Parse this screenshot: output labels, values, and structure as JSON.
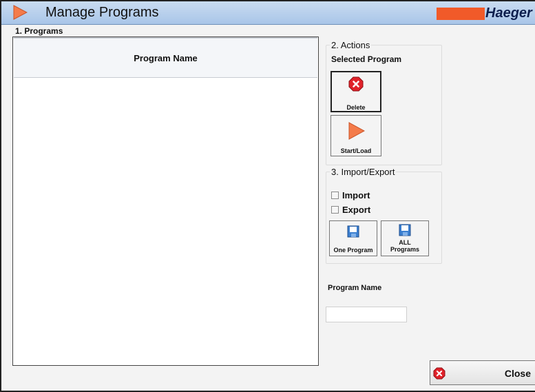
{
  "window": {
    "title": "Manage Programs",
    "brand": "Haeger",
    "brand_color": "#f15a29",
    "title_icon": "play-arrow-icon"
  },
  "programs": {
    "group_label": "1. Programs",
    "columns": [
      "Program Name"
    ],
    "rows": []
  },
  "actions": {
    "group_label": "2. Actions",
    "sub_label": "Selected Program",
    "delete_label": "Delete",
    "delete_icon": "delete-x-icon",
    "start_label": "Start/Load",
    "start_icon": "play-arrow-icon"
  },
  "import_export": {
    "group_label": "3. Import/Export",
    "import_label": "Import",
    "import_checked": false,
    "export_label": "Export",
    "export_checked": false,
    "one_program_label": "One Program",
    "all_programs_label_1": "ALL",
    "all_programs_label_2": "Programs",
    "save_icon": "floppy-disk-icon"
  },
  "program_name": {
    "label": "Program Name",
    "value": ""
  },
  "close_label": "Close",
  "close_icon": "close-x-icon"
}
